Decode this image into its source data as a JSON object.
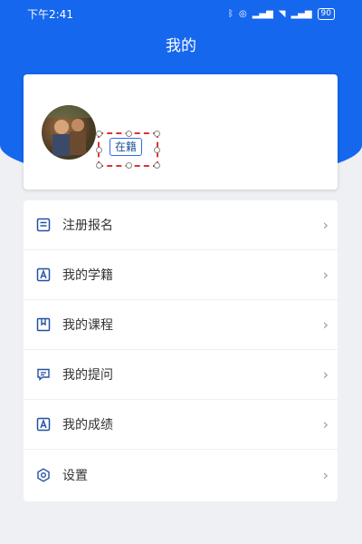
{
  "status_bar": {
    "time": "下午2:41",
    "icons": [
      "bluetooth-icon",
      "alarm-icon",
      "signal-icon",
      "wifi-icon",
      "signal-icon"
    ],
    "battery": "90"
  },
  "header": {
    "title": "我的"
  },
  "profile": {
    "avatar": "avatar-photo",
    "status_badge": "在籍"
  },
  "menu": {
    "items": [
      {
        "label": "注册报名",
        "icon": "form-icon"
      },
      {
        "label": "我的学籍",
        "icon": "student-id-icon"
      },
      {
        "label": "我的课程",
        "icon": "course-book-icon"
      },
      {
        "label": "我的提问",
        "icon": "question-chat-icon"
      },
      {
        "label": "我的成绩",
        "icon": "grade-icon"
      },
      {
        "label": "设置",
        "icon": "settings-icon"
      }
    ],
    "chevron": "›"
  },
  "colors": {
    "accent": "#1567ee",
    "icon": "#2450a4",
    "selection": "#e0322f"
  }
}
